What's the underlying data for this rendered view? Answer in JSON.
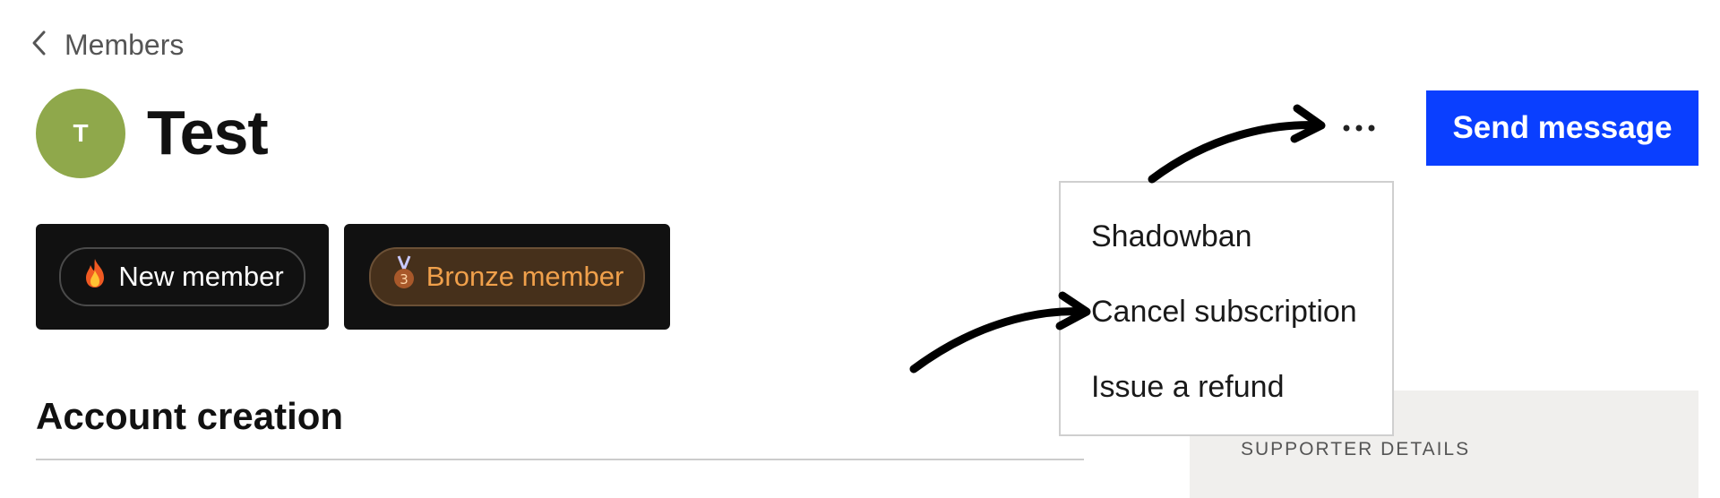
{
  "breadcrumb": {
    "label": "Members",
    "icon": "chevron-left-icon"
  },
  "member": {
    "initial": "T",
    "name": "Test",
    "avatar_color": "#8fa84b"
  },
  "badges": [
    {
      "label": "New member",
      "icon": "fire-icon"
    },
    {
      "label": "Bronze member",
      "icon": "bronze-medal-icon"
    }
  ],
  "actions": {
    "more_icon": "ellipsis-icon",
    "send_message_label": "Send message",
    "accent_color": "#0a3fff"
  },
  "menu": {
    "items": [
      {
        "label": "Shadowban"
      },
      {
        "label": "Cancel subscription"
      },
      {
        "label": "Issue a refund"
      }
    ]
  },
  "section": {
    "title": "Account creation"
  },
  "sidebar": {
    "supporter_details_label": "SUPPORTER DETAILS"
  }
}
